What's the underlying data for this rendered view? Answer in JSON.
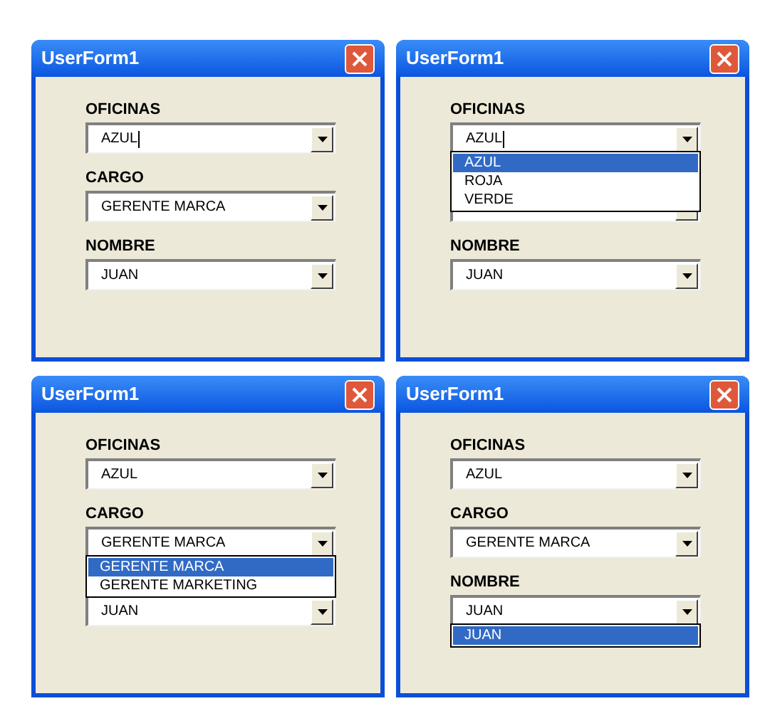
{
  "windows": [
    {
      "title": "UserForm1",
      "fields": [
        {
          "kind": "combo",
          "label": "OFICINAS",
          "value": "AZUL",
          "cursor": true
        },
        {
          "kind": "combo",
          "label": "CARGO",
          "value": "GERENTE MARCA",
          "cursor": false
        },
        {
          "kind": "combo",
          "label": "NOMBRE",
          "value": "JUAN",
          "cursor": false
        }
      ]
    },
    {
      "title": "UserForm1",
      "fields": [
        {
          "kind": "combo",
          "label": "OFICINAS",
          "value": "AZUL",
          "cursor": true,
          "list": [
            {
              "label": "AZUL",
              "selected": true
            },
            {
              "label": "ROJA",
              "selected": false
            },
            {
              "label": "VERDE",
              "selected": false
            }
          ]
        },
        {
          "kind": "covered"
        },
        {
          "kind": "combo",
          "label": "NOMBRE",
          "value": "JUAN",
          "cursor": false
        }
      ]
    },
    {
      "title": "UserForm1",
      "fields": [
        {
          "kind": "combo",
          "label": "OFICINAS",
          "value": "AZUL",
          "cursor": false
        },
        {
          "kind": "combo",
          "label": "CARGO",
          "value": "GERENTE MARCA",
          "cursor": false,
          "list": [
            {
              "label": "GERENTE MARCA",
              "selected": true
            },
            {
              "label": "GERENTE MARKETING",
              "selected": false
            }
          ]
        },
        {
          "kind": "combo",
          "value": "JUAN",
          "cursor": false
        }
      ]
    },
    {
      "title": "UserForm1",
      "fields": [
        {
          "kind": "combo",
          "label": "OFICINAS",
          "value": "AZUL",
          "cursor": false
        },
        {
          "kind": "combo",
          "label": "CARGO",
          "value": "GERENTE MARCA",
          "cursor": false
        },
        {
          "kind": "combo",
          "label": "NOMBRE",
          "value": "JUAN",
          "cursor": false,
          "list": [
            {
              "label": "JUAN",
              "selected": true
            }
          ]
        }
      ]
    }
  ]
}
